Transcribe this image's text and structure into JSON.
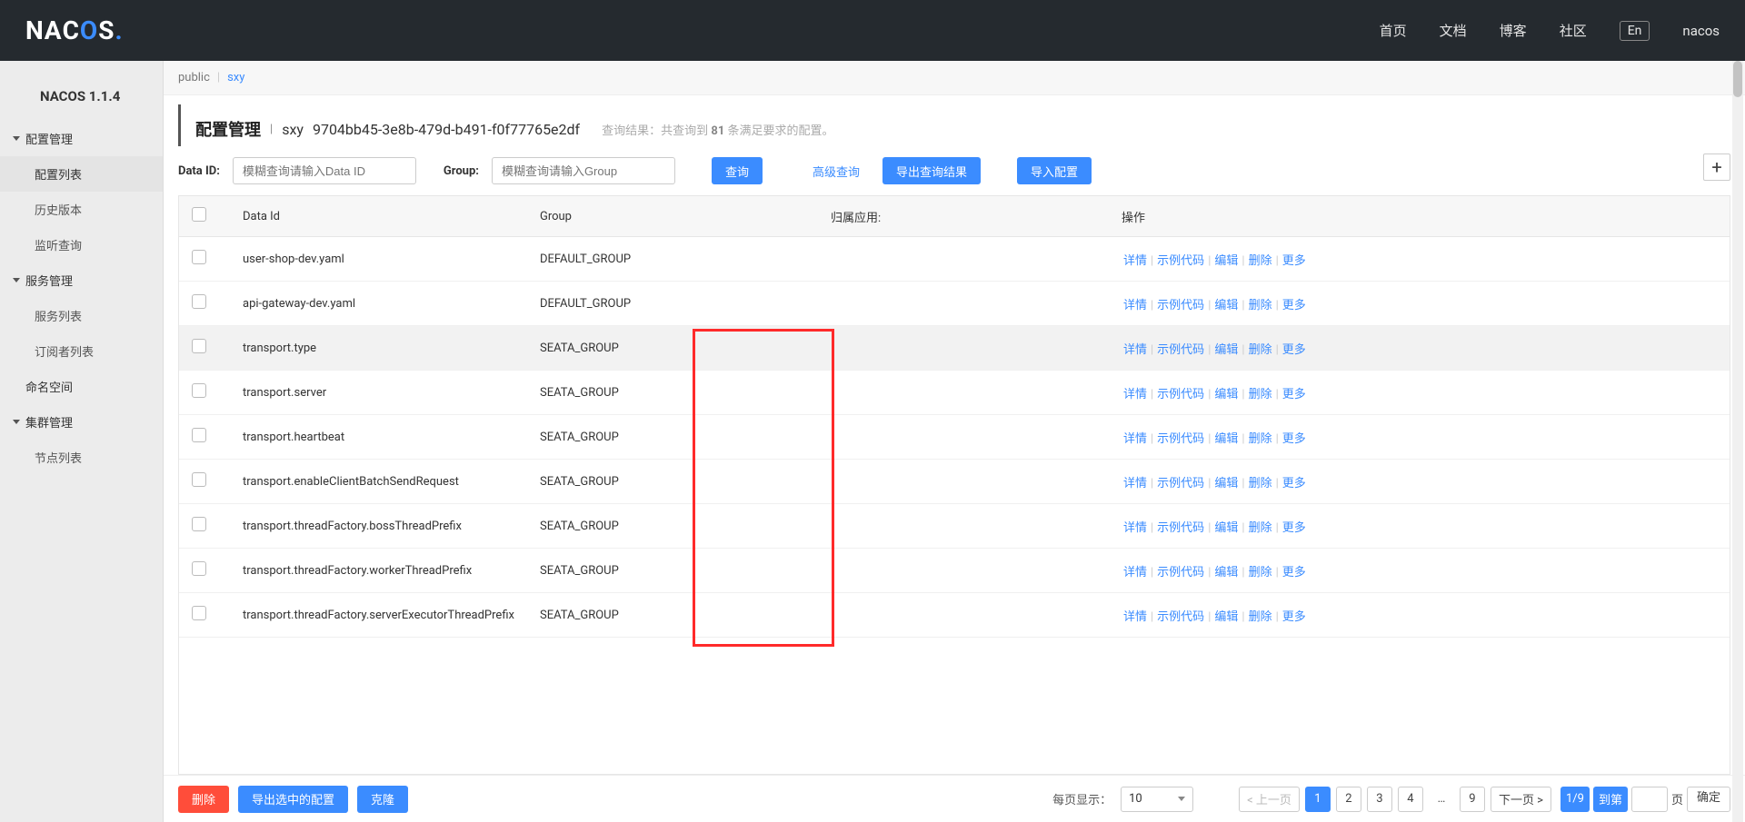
{
  "header": {
    "logo_text": "NACOS.",
    "nav": [
      "首页",
      "文档",
      "博客",
      "社区"
    ],
    "lang": "En",
    "user": "nacos"
  },
  "sidebar": {
    "version": "NACOS 1.1.4",
    "groups": [
      {
        "label": "配置管理",
        "expanded": true,
        "items": [
          "配置列表",
          "历史版本",
          "监听查询"
        ],
        "activeIndex": 0
      },
      {
        "label": "服务管理",
        "expanded": true,
        "items": [
          "服务列表",
          "订阅者列表"
        ]
      },
      {
        "label": "命名空间",
        "expanded": false,
        "items": [],
        "noarrow": true
      },
      {
        "label": "集群管理",
        "expanded": true,
        "items": [
          "节点列表"
        ]
      }
    ]
  },
  "namespaces": {
    "public": "public",
    "sep": "|",
    "sxy": "sxy",
    "active": "sxy"
  },
  "pageTitle": {
    "main": "配置管理",
    "sep": "|",
    "ns": "sxy",
    "nsid": "9704bb45-3e8b-479d-b491-f0f77765e2df",
    "resultPrefix": "查询结果：共查询到 ",
    "resultCount": "81",
    "resultSuffix": " 条满足要求的配置。"
  },
  "filter": {
    "dataid_label": "Data ID:",
    "dataid_placeholder": "模糊查询请输入Data ID",
    "group_label": "Group:",
    "group_placeholder": "模糊查询请输入Group",
    "query_btn": "查询",
    "adv_query": "高级查询",
    "export_btn": "导出查询结果",
    "import_btn": "导入配置",
    "add_tip": "+"
  },
  "table": {
    "headers": {
      "dataId": "Data Id",
      "group": "Group",
      "app": "归属应用:",
      "op": "操作"
    },
    "ops": {
      "detail": "详情",
      "sample": "示例代码",
      "edit": "编辑",
      "delete": "删除",
      "more": "更多"
    },
    "rows": [
      {
        "dataId": "user-shop-dev.yaml",
        "group": "DEFAULT_GROUP",
        "app": "",
        "hovered": false
      },
      {
        "dataId": "api-gateway-dev.yaml",
        "group": "DEFAULT_GROUP",
        "app": "",
        "hovered": false
      },
      {
        "dataId": "transport.type",
        "group": "SEATA_GROUP",
        "app": "",
        "hovered": true
      },
      {
        "dataId": "transport.server",
        "group": "SEATA_GROUP",
        "app": "",
        "hovered": false
      },
      {
        "dataId": "transport.heartbeat",
        "group": "SEATA_GROUP",
        "app": "",
        "hovered": false
      },
      {
        "dataId": "transport.enableClientBatchSendRequest",
        "group": "SEATA_GROUP",
        "app": "",
        "hovered": false
      },
      {
        "dataId": "transport.threadFactory.bossThreadPrefix",
        "group": "SEATA_GROUP",
        "app": "",
        "hovered": false
      },
      {
        "dataId": "transport.threadFactory.workerThreadPrefix",
        "group": "SEATA_GROUP",
        "app": "",
        "hovered": false
      },
      {
        "dataId": "transport.threadFactory.serverExecutorThreadPrefix",
        "group": "SEATA_GROUP",
        "app": "",
        "hovered": false
      }
    ]
  },
  "footer": {
    "delete": "删除",
    "exportSel": "导出选中的配置",
    "clone": "克隆",
    "pageSizeLabel": "每页显示：",
    "pageSize": "10",
    "prev": "< 上一页",
    "next": "下一页 >",
    "pages": [
      "1",
      "2",
      "3",
      "4",
      "…",
      "9"
    ],
    "confirm": "确定",
    "gotoPrefix": "1/9",
    "gotoLabel": "到第",
    "gotoSuffix": "页"
  }
}
